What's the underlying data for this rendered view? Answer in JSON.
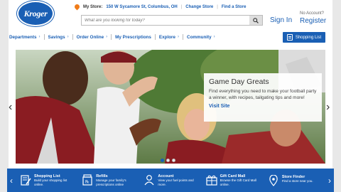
{
  "header": {
    "logo_text": "Kroger",
    "my_store_label": "My Store:",
    "store_address": "150 W Sycamore St, Columbus, OH",
    "change_store": "Change Store",
    "find_store": "Find a Store",
    "search_placeholder": "What are you looking for today?",
    "sign_in": "Sign In",
    "no_account": "No Account?",
    "register": "Register"
  },
  "nav": {
    "items": [
      "Departments",
      "Savings",
      "Order Online",
      "My Prescriptions",
      "Explore",
      "Community"
    ],
    "shopping_list": "Shopping List"
  },
  "hero": {
    "title": "Game Day Greats",
    "body": "Find everything you need to make your football party a winner, with recipes, tailgating tips and more!",
    "cta": "Visit Site",
    "prev_icon": "chevron-left-icon",
    "next_icon": "chevron-right-icon",
    "slides": 3,
    "active_slide": 1
  },
  "footer": {
    "items": [
      {
        "title": "Shopping List",
        "desc": "Build your shopping list online.",
        "icon": "list-pencil-icon"
      },
      {
        "title": "Refills",
        "desc": "Manage your family's prescriptions online",
        "icon": "rx-bottle-icon"
      },
      {
        "title": "Account",
        "desc": "View your fuel points and more.",
        "icon": "person-icon"
      },
      {
        "title": "Gift Card Mall",
        "desc": "Browse the Gift Card Mall online.",
        "icon": "gift-icon"
      },
      {
        "title": "Store Finder",
        "desc": "Find a store near you.",
        "icon": "map-pin-icon"
      }
    ]
  },
  "colors": {
    "brand_blue": "#1a5fb4",
    "accent_orange": "#f07c19"
  }
}
